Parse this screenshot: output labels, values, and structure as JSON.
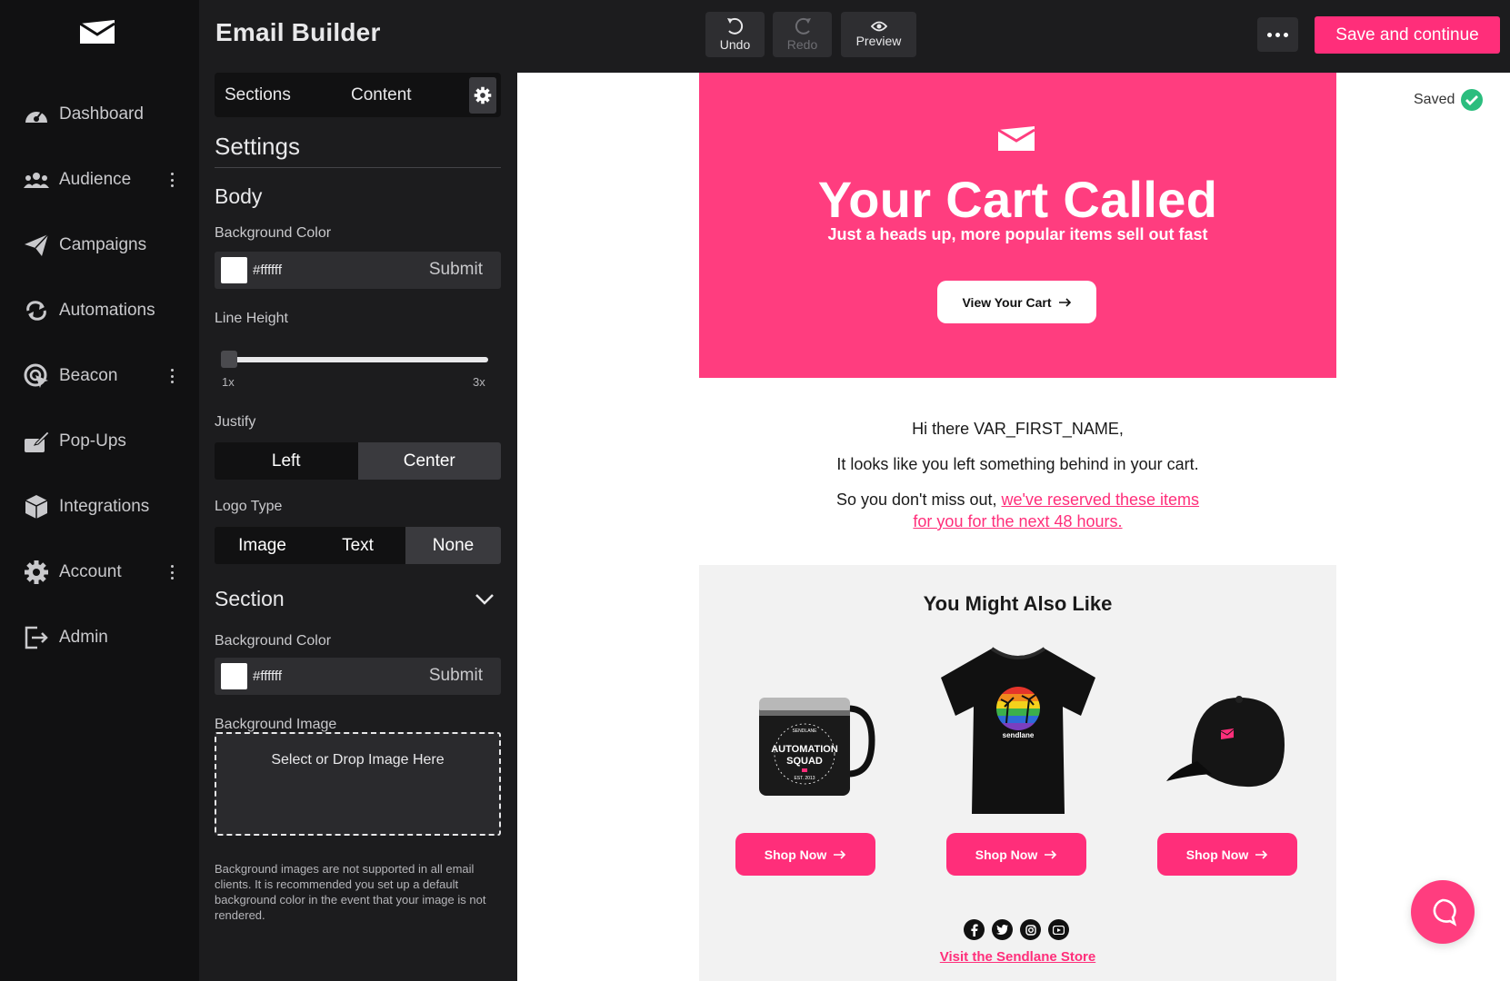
{
  "app": {
    "title": "Email Builder"
  },
  "nav": {
    "items": [
      {
        "label": "Dashboard",
        "icon": "dashboard-icon"
      },
      {
        "label": "Audience",
        "icon": "audience-icon",
        "more": true
      },
      {
        "label": "Campaigns",
        "icon": "paper-plane-icon"
      },
      {
        "label": "Automations",
        "icon": "cycle-icon"
      },
      {
        "label": "Beacon",
        "icon": "beacon-icon",
        "more": true
      },
      {
        "label": "Pop-Ups",
        "icon": "popup-icon"
      },
      {
        "label": "Integrations",
        "icon": "box-icon"
      },
      {
        "label": "Account",
        "icon": "gear-icon",
        "more": true
      },
      {
        "label": "Admin",
        "icon": "logout-icon"
      }
    ]
  },
  "toolbar": {
    "undo": "Undo",
    "redo": "Redo",
    "preview": "Preview",
    "save": "Save and continue"
  },
  "panel": {
    "tabs": {
      "sections": "Sections",
      "content": "Content"
    },
    "settings_title": "Settings",
    "body": {
      "title": "Body",
      "bg_label": "Background Color",
      "bg_value": "#ffffff",
      "submit": "Submit",
      "line_height_label": "Line Height",
      "line_height_min": "1x",
      "line_height_max": "3x",
      "line_height_value": 0,
      "justify_label": "Justify",
      "justify_options": [
        "Left",
        "Center"
      ],
      "justify_selected": "Center",
      "logo_type_label": "Logo Type",
      "logo_type_options": [
        "Image",
        "Text",
        "None"
      ],
      "logo_type_selected": "None"
    },
    "section": {
      "title": "Section",
      "bg_label": "Background Color",
      "bg_value": "#ffffff",
      "submit": "Submit",
      "bg_image_label": "Background Image",
      "dropzone": "Select or Drop Image Here",
      "note": "Background images are not supported in all email clients. It is recommended you set up a default background color in the event that your image is not rendered."
    }
  },
  "status": {
    "saved": "Saved"
  },
  "email": {
    "hero_title": "Your Cart Called",
    "hero_subtitle": "Just a heads up, more popular items sell out fast",
    "hero_button": "View Your Cart",
    "greeting": "Hi there VAR_FIRST_NAME,",
    "line1": "It looks like you left something behind in your cart.",
    "line2_prefix": "So you don't miss out, ",
    "line2_link_a": "we've reserved these items",
    "line2_link_b": "for you for the next 48 hours.",
    "recommend_title": "You Might Also Like",
    "mug_text_top": "SENDLANE",
    "mug_text_main1": "AUTOMATION",
    "mug_text_main2": "SQUAD",
    "mug_text_bottom": "EST. 2013",
    "shirt_text": "sendlane",
    "shop_button": "Shop Now",
    "store_link": "Visit the Sendlane Store",
    "socials": [
      "facebook-icon",
      "twitter-icon",
      "instagram-icon",
      "youtube-icon"
    ]
  },
  "colors": {
    "brand_pink": "#ff2e7a",
    "hero_pink": "#ff3d7f",
    "nav_bg": "#111112",
    "panel_bg": "#1c1c1e",
    "saved_green": "#2bbd7e"
  }
}
